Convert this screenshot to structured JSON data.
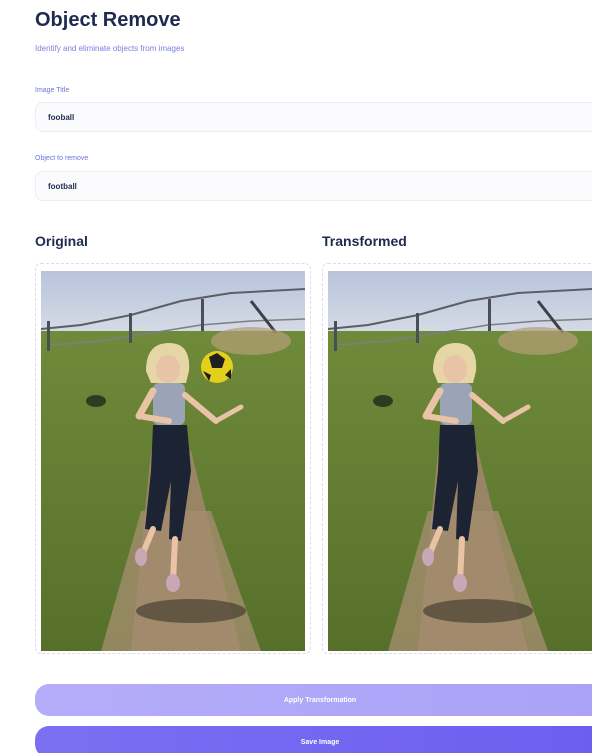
{
  "header": {
    "title": "Object Remove",
    "subtitle": "Identify and eliminate objects from images"
  },
  "form": {
    "image_title_label": "Image Title",
    "image_title_value": "fooball",
    "object_label": "Object to remove",
    "object_value": "football"
  },
  "preview": {
    "original_heading": "Original",
    "transformed_heading": "Transformed"
  },
  "actions": {
    "apply_label": "Apply Transformation",
    "save_label": "Save Image"
  },
  "colors": {
    "heading": "#1f2a4f",
    "accent": "#6c5ef0",
    "accent_light": "#b5adfa"
  }
}
